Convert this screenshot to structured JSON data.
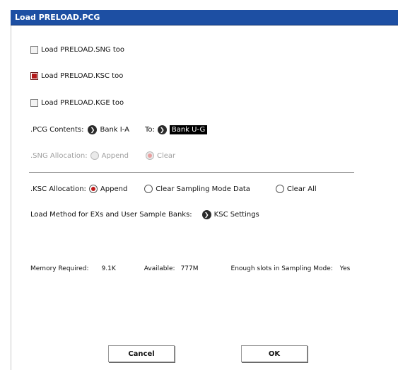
{
  "title": "Load PRELOAD.PCG",
  "checkboxes": {
    "sng": {
      "label": "Load PRELOAD.SNG too",
      "checked": false
    },
    "ksc": {
      "label": "Load PRELOAD.KSC too",
      "checked": true
    },
    "kge": {
      "label": "Load PRELOAD.KGE too",
      "checked": false
    }
  },
  "pcg_contents": {
    "label": ".PCG Contents:",
    "value": "Bank I-A",
    "to_label": "To:",
    "to_value": "Bank U-G"
  },
  "sng_allocation": {
    "label": ".SNG Allocation:",
    "options": [
      "Append",
      "Clear"
    ],
    "selected": "Clear",
    "disabled": true
  },
  "ksc_allocation": {
    "label": ".KSC Allocation:",
    "options": [
      "Append",
      "Clear Sampling Mode Data",
      "Clear All"
    ],
    "selected": "Append"
  },
  "load_method": {
    "label": "Load Method for EXs and User Sample Banks:",
    "button": "KSC Settings"
  },
  "memory": {
    "required_label": "Memory Required:",
    "required_value": "9.1K",
    "available_label": "Available:",
    "available_value": "777M",
    "slots_label": "Enough slots in Sampling Mode:",
    "slots_value": "Yes"
  },
  "buttons": {
    "cancel": "Cancel",
    "ok": "OK"
  },
  "colors": {
    "titlebar": "#1d4fa3",
    "radio_selected": "#c01818"
  }
}
